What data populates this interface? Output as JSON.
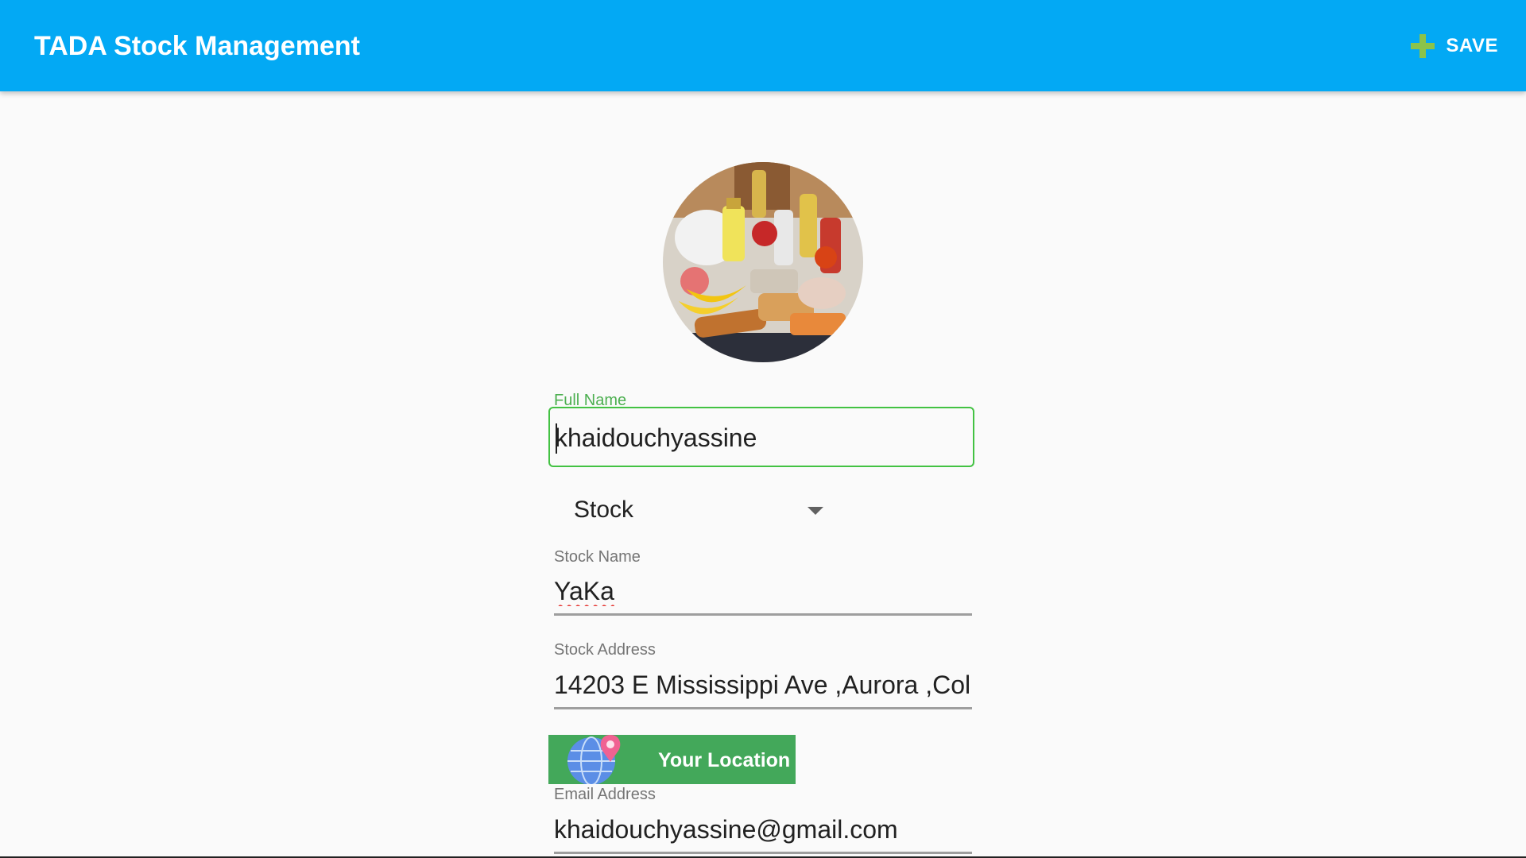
{
  "appbar": {
    "title": "TADA Stock Management",
    "save_label": "SAVE",
    "save_icon": "plus-icon",
    "background_color": "#03a9f4",
    "save_icon_color": "#8bc34a"
  },
  "avatar": {
    "description_icon": "groceries-photo"
  },
  "form": {
    "full_name": {
      "label": "Full Name",
      "value": "khaidouchyassine",
      "focused": true,
      "focus_color": "#43c243"
    },
    "type_dropdown": {
      "selected": "Stock"
    },
    "stock_name": {
      "label": "Stock Name",
      "value": "YaKa"
    },
    "stock_address": {
      "label": "Stock Address",
      "value": "14203 E Mississippi Ave ,Aurora ,Col"
    },
    "location_button": {
      "label": "Your Location",
      "icon": "globe-pin-icon",
      "color": "#43a85a"
    },
    "email": {
      "label": "Email Address",
      "value": "khaidouchyassine@gmail.com"
    }
  }
}
